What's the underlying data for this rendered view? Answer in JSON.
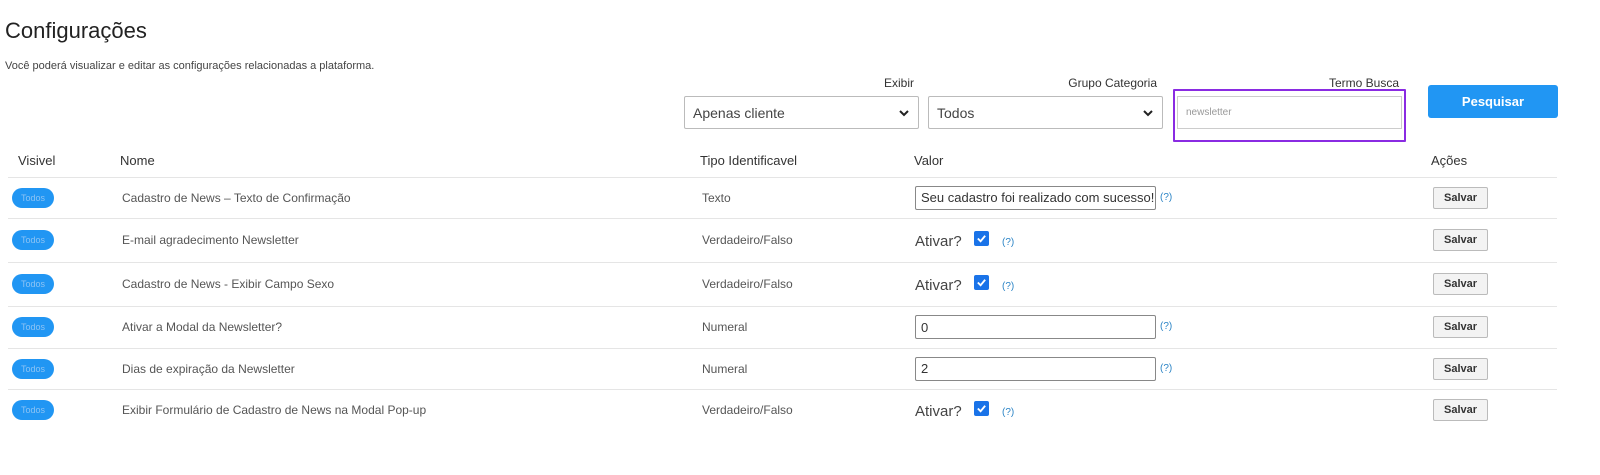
{
  "page": {
    "title": "Configurações",
    "subtitle": "Você poderá visualizar e editar as configurações relacionadas a plataforma."
  },
  "filters": {
    "exibir": {
      "label": "Exibir",
      "value": "Apenas cliente"
    },
    "grupo": {
      "label": "Grupo Categoria",
      "value": "Todos"
    },
    "termo": {
      "label": "Termo Busca",
      "value": "newsletter"
    },
    "search_button": "Pesquisar"
  },
  "table": {
    "headers": {
      "visivel": "Visivel",
      "nome": "Nome",
      "tipo": "Tipo Identificavel",
      "valor": "Valor",
      "acoes": "Ações"
    },
    "rows": [
      {
        "badge": "Todos",
        "nome": "Cadastro de News – Texto de Confirmação",
        "tipo": "Texto",
        "valor_type": "text",
        "valor": "Seu cadastro foi realizado com sucesso!",
        "help": "(?)",
        "action": "Salvar"
      },
      {
        "badge": "Todos",
        "nome": "E-mail agradecimento Newsletter",
        "tipo": "Verdadeiro/Falso",
        "valor_type": "checkbox",
        "valor": "Ativar?",
        "checked": true,
        "help": "(?)",
        "action": "Salvar"
      },
      {
        "badge": "Todos",
        "nome": "Cadastro de News - Exibir Campo Sexo",
        "tipo": "Verdadeiro/Falso",
        "valor_type": "checkbox",
        "valor": "Ativar?",
        "checked": true,
        "help": "(?)",
        "action": "Salvar"
      },
      {
        "badge": "Todos",
        "nome": "Ativar a Modal da Newsletter?",
        "tipo": "Numeral",
        "valor_type": "text",
        "valor": "0",
        "help": "(?)",
        "action": "Salvar"
      },
      {
        "badge": "Todos",
        "nome": "Dias de expiração da Newsletter",
        "tipo": "Numeral",
        "valor_type": "text",
        "valor": "2",
        "help": "(?)",
        "action": "Salvar"
      },
      {
        "badge": "Todos",
        "nome": "Exibir Formulário de Cadastro de News na Modal Pop-up",
        "tipo": "Verdadeiro/Falso",
        "valor_type": "checkbox",
        "valor": "Ativar?",
        "checked": true,
        "help": "(?)",
        "action": "Salvar"
      }
    ]
  },
  "colors": {
    "accent": "#2196f3",
    "highlight_border": "#8a2be2",
    "checkbox": "#1a73e8"
  }
}
